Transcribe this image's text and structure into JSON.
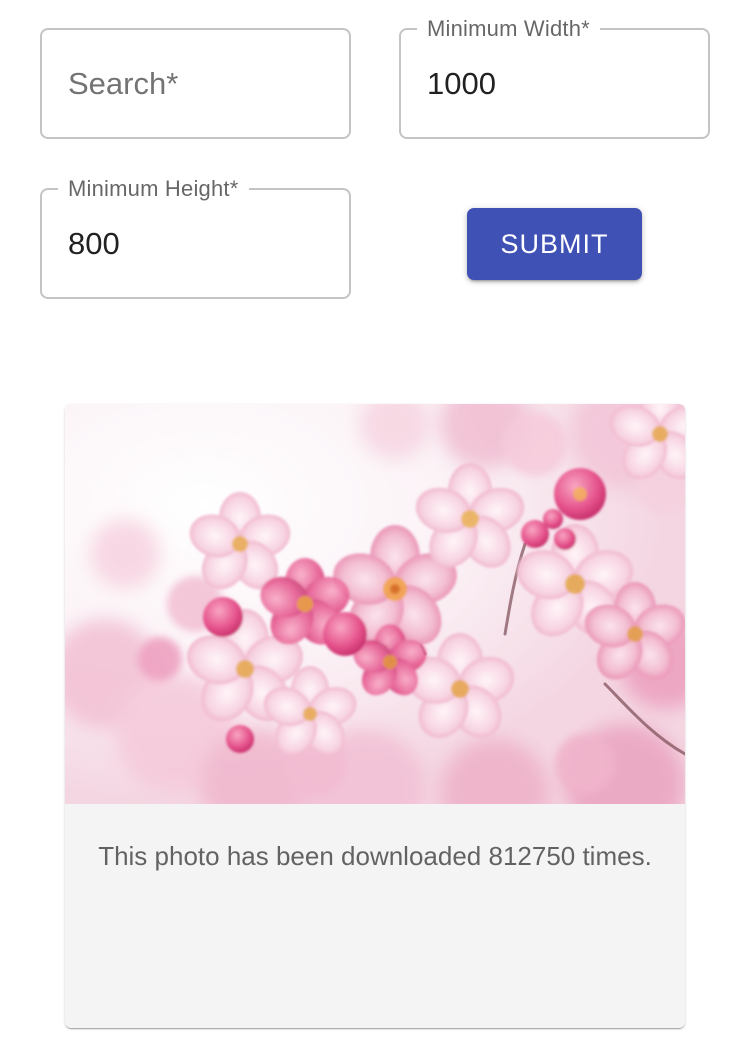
{
  "form": {
    "search": {
      "placeholder": "Search*",
      "value": ""
    },
    "min_width": {
      "label": "Minimum Width*",
      "value": "1000"
    },
    "min_height": {
      "label": "Minimum Height*",
      "value": "800"
    },
    "submit_label": "Submit"
  },
  "card": {
    "image_subject": "pink-cherry-blossoms",
    "caption": "This photo has been downloaded 812750 times."
  },
  "colors": {
    "primary": "#3f51b5",
    "card_background": "#f4f4f4",
    "field_border": "#c4c4c4"
  }
}
